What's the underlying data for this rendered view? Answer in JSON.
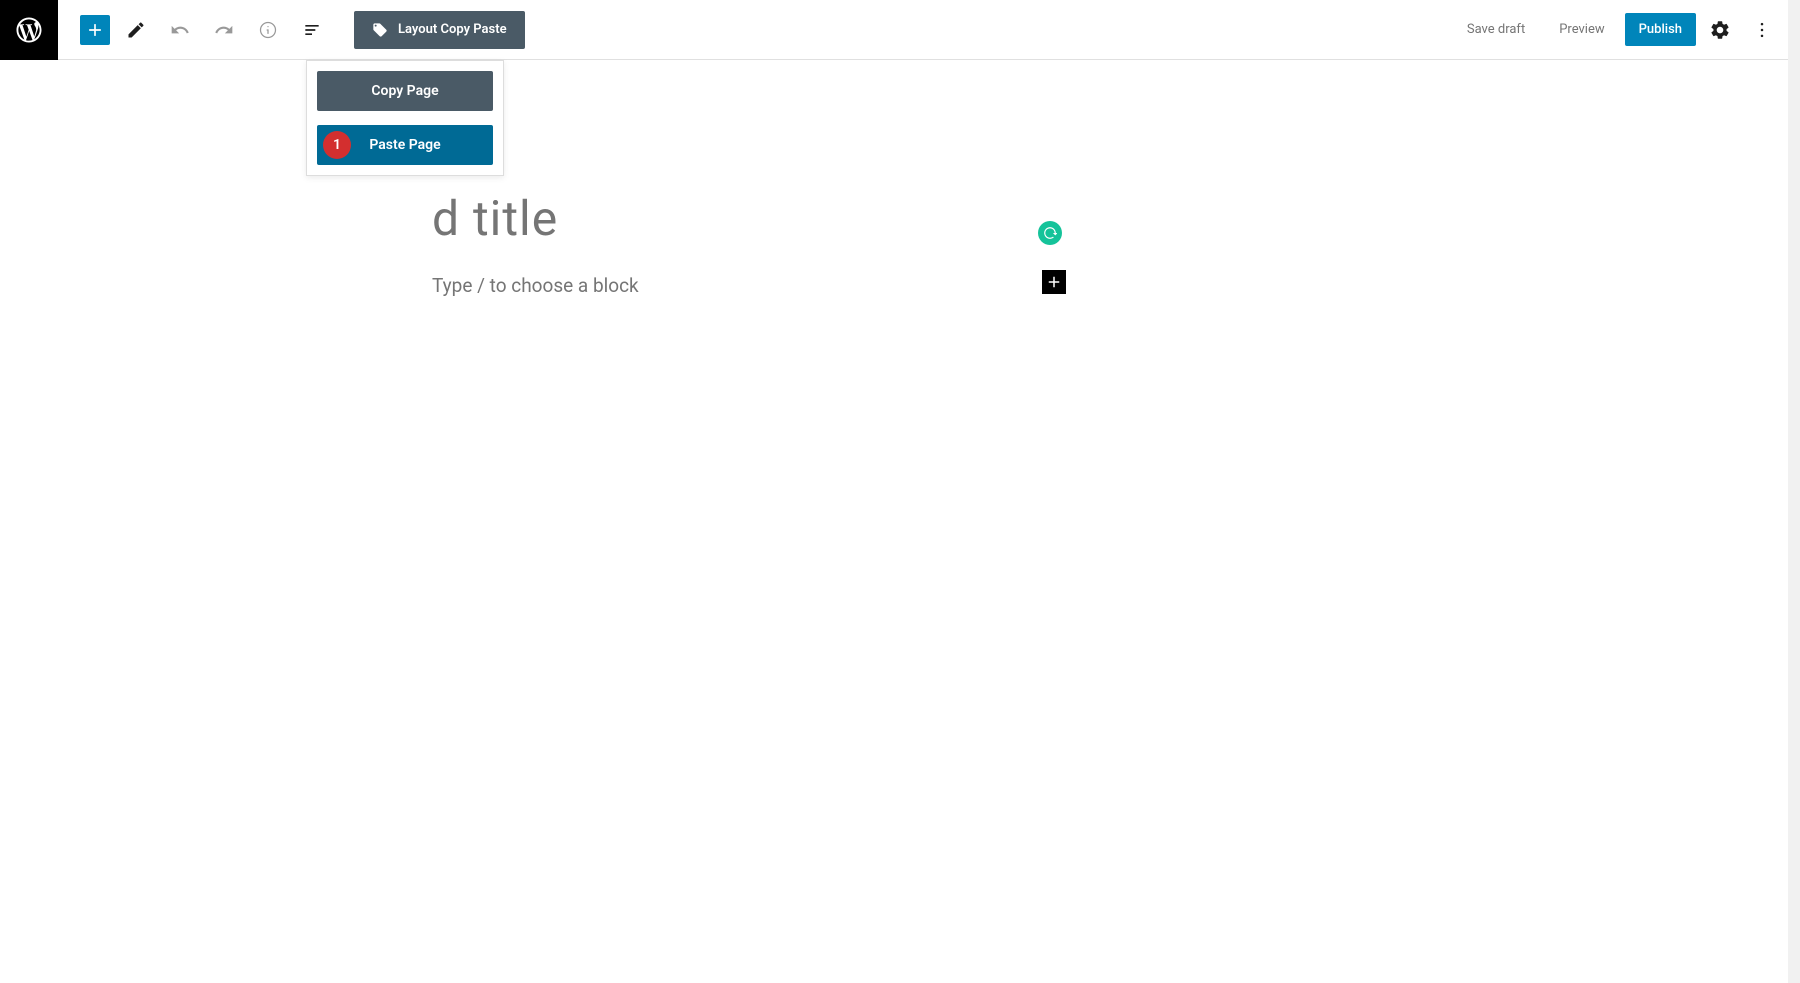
{
  "toolbar": {
    "layout_button_label": "Layout Copy Paste",
    "save_draft_label": "Save draft",
    "preview_label": "Preview",
    "publish_label": "Publish"
  },
  "dropdown": {
    "copy_page_label": "Copy Page",
    "paste_page_label": "Paste Page",
    "annotation_number": "1"
  },
  "editor": {
    "title_placeholder": "d title",
    "block_placeholder": "Type / to choose a block"
  },
  "colors": {
    "primary_blue": "#0085ba",
    "toolbar_dark": "#4a5a66",
    "dropdown_blue": "#006a95",
    "badge_red": "#d32f2f",
    "grammarly_green": "#15c39a"
  }
}
